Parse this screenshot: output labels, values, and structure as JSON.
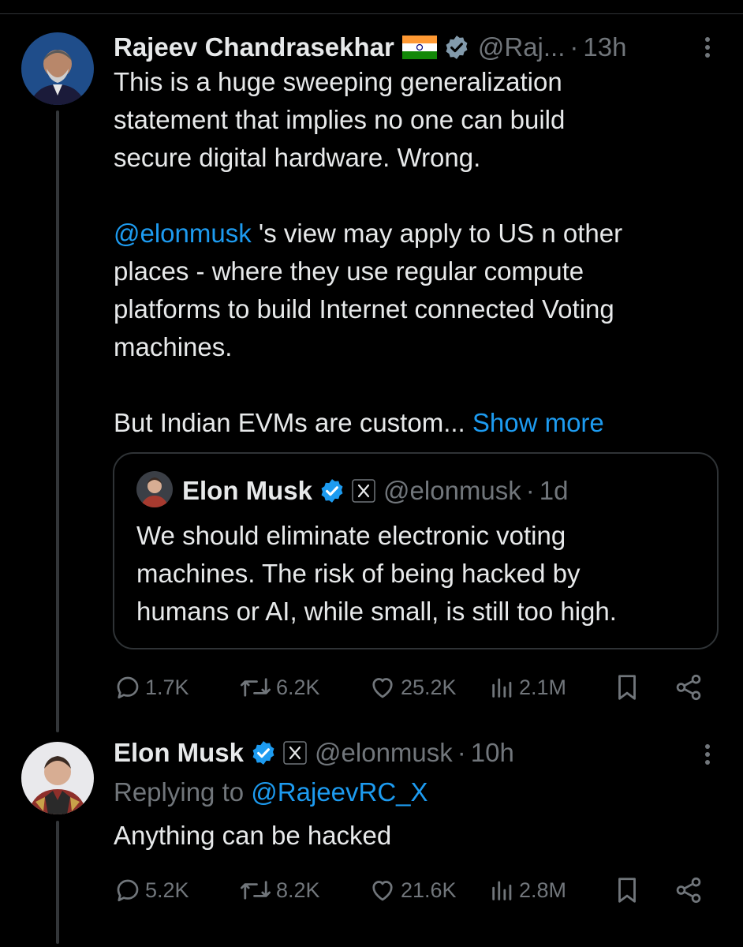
{
  "tweet1": {
    "author_name": "Rajeev Chandrasekhar",
    "handle": "@Raj...",
    "separator": "·",
    "time": "13h",
    "text_lines_p1": [
      "This is a huge sweeping generalization",
      "statement that implies no one can build",
      "secure digital hardware. Wrong."
    ],
    "mention": "@elonmusk",
    "p2_line1_rest": " 's view may apply to US n other",
    "p2_lines_rest": [
      "places - where they use regular compute",
      "platforms to build Internet connected Voting",
      "machines."
    ],
    "p3_text": "But Indian EVMs are custom... ",
    "show_more": "Show more",
    "quoted": {
      "author_name": "Elon Musk",
      "handle": "@elonmusk",
      "separator": "·",
      "time": "1d",
      "text_lines": [
        "We should eliminate electronic voting",
        "machines. The risk of being hacked by",
        "humans or AI, while small, is still too high."
      ]
    },
    "stats": {
      "replies": "1.7K",
      "reposts": "6.2K",
      "likes": "25.2K",
      "views": "2.1M"
    }
  },
  "tweet2": {
    "author_name": "Elon Musk",
    "handle": "@elonmusk",
    "separator": "·",
    "time": "10h",
    "replying_prefix": "Replying to ",
    "replying_to": "@RajeevRC_X",
    "text": "Anything can be hacked",
    "stats": {
      "replies": "5.2K",
      "reposts": "8.2K",
      "likes": "21.6K",
      "views": "2.8M"
    }
  },
  "icons": [
    "more-vertical-icon",
    "verified-badge-icon",
    "india-flag-icon",
    "x-affiliate-badge-icon",
    "reply-icon",
    "repost-icon",
    "like-icon",
    "views-icon",
    "bookmark-icon",
    "share-icon"
  ],
  "colors": {
    "background": "#000000",
    "text": "#e7e9ea",
    "secondary": "#71767b",
    "link": "#1d9bf0",
    "border": "#2f3336"
  }
}
